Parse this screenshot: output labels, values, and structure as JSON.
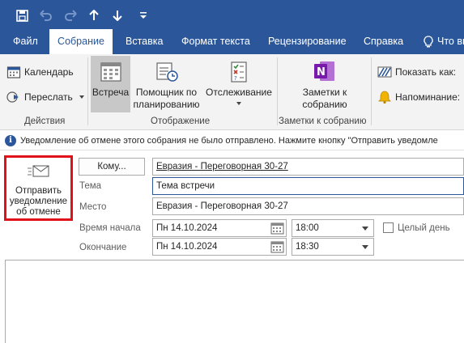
{
  "quick_access": {
    "items": [
      "save-icon",
      "undo-icon",
      "redo-icon",
      "arrow-up-icon",
      "arrow-down-icon",
      "customize-icon"
    ]
  },
  "tabs": [
    {
      "label": "Файл"
    },
    {
      "label": "Собрание"
    },
    {
      "label": "Вставка"
    },
    {
      "label": "Формат текста"
    },
    {
      "label": "Рецензирование"
    },
    {
      "label": "Справка"
    },
    {
      "label": "Что вы"
    }
  ],
  "ribbon": {
    "actions": {
      "calendar": "Календарь",
      "forward": "Переслать",
      "group": "Действия"
    },
    "display": {
      "meeting": "Встреча",
      "assistant": "Помощник по планированию",
      "assistant_line1": "Помощник по",
      "assistant_line2": "планированию",
      "tracking": "Отслеживание",
      "group": "Отображение"
    },
    "notes": {
      "line1": "Заметки к",
      "line2": "собранию",
      "group": "Заметки к собранию"
    },
    "options": {
      "show_as": "Показать как:",
      "reminder": "Напоминание:"
    }
  },
  "infobar": {
    "text": "Уведомление об отмене этого собрания не было отправлено. Нажмите кнопку \"Отправить уведомле"
  },
  "send_button": {
    "line1": "Отправить",
    "line2": "уведомление",
    "line3": "об отмене"
  },
  "form": {
    "to_button": "Кому...",
    "to_value": "Евразия - Переговорная 30-27",
    "subject_label": "Тема",
    "subject_value": "Тема встречи",
    "location_label": "Место",
    "location_value": "Евразия - Переговорная 30-27",
    "start_label": "Время начала",
    "start_date": "Пн 14.10.2024",
    "start_time": "18:00",
    "allday_label": "Целый день",
    "end_label": "Окончание",
    "end_date": "Пн 14.10.2024",
    "end_time": "18:30"
  },
  "colors": {
    "brand": "#2b579a",
    "highlight_border": "#e0111a",
    "onenote": "#7719aa"
  }
}
